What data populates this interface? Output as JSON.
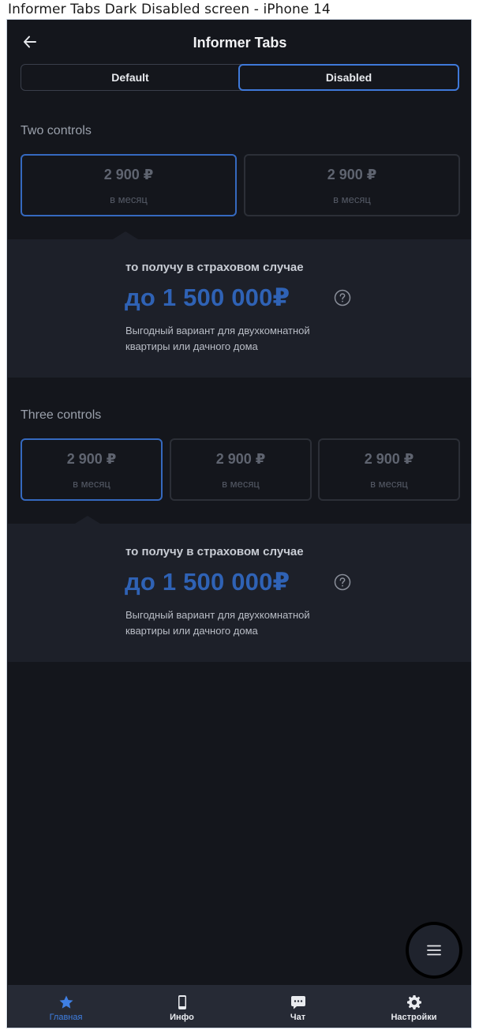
{
  "caption": "Informer Tabs Dark Disabled screen - iPhone 14",
  "header": {
    "title": "Informer Tabs"
  },
  "segmented": {
    "options": [
      "Default",
      "Disabled"
    ],
    "selected": "Disabled"
  },
  "two_controls": {
    "title": "Two controls",
    "tabs": [
      {
        "price": "2 900 ₽",
        "period": "в месяц"
      },
      {
        "price": "2 900 ₽",
        "period": "в месяц"
      }
    ],
    "informer": {
      "subtitle": "то получу в страховом случае",
      "amount": "до 1 500 000₽",
      "desc_line1": "Выгодный вариант для  двухкомнатной",
      "desc_line2": "квартиры или дачного дома"
    }
  },
  "three_controls": {
    "title": "Three controls",
    "tabs": [
      {
        "price": "2 900 ₽",
        "period": "в месяц"
      },
      {
        "price": "2 900 ₽",
        "period": "в месяц"
      },
      {
        "price": "2 900 ₽",
        "period": "в месяц"
      }
    ],
    "informer": {
      "subtitle": "то получу в страховом случае",
      "amount": "до 1 500 000₽",
      "desc_line1": "Выгодный вариант для  двухкомнатной",
      "desc_line2": "квартиры или дачного дома"
    }
  },
  "tabbar": {
    "items": [
      {
        "label": "Главная",
        "icon": "star-icon"
      },
      {
        "label": "Инфо",
        "icon": "phone-icon"
      },
      {
        "label": "Чат",
        "icon": "chat-icon"
      },
      {
        "label": "Настройки",
        "icon": "gear-icon"
      }
    ],
    "active": "Главная"
  },
  "colors": {
    "background": "#14161c",
    "accent": "#3f79d9",
    "amount": "#2f62b5",
    "informer_bg": "#1d2029",
    "tabbar_bg": "#262a35"
  }
}
